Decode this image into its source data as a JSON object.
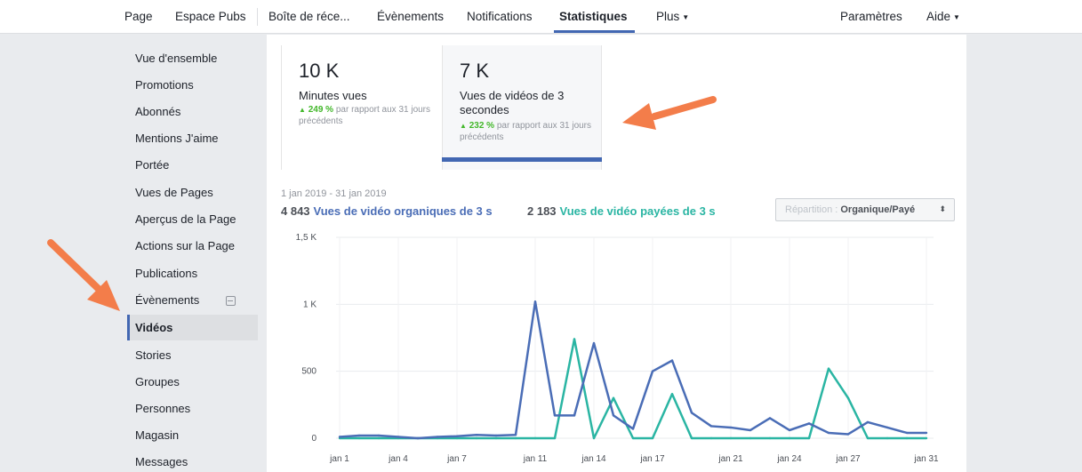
{
  "nav": {
    "items": [
      "Page",
      "Espace Pubs",
      "Boîte de réce...",
      "Évènements",
      "Notifications",
      "Statistiques",
      "Plus",
      "Paramètres",
      "Aide"
    ],
    "active": "Statistiques"
  },
  "sidebar": {
    "items": [
      "Vue d'ensemble",
      "Promotions",
      "Abonnés",
      "Mentions J'aime",
      "Portée",
      "Vues de Pages",
      "Aperçus de la Page",
      "Actions sur la Page",
      "Publications",
      "Évènements",
      "Vidéos",
      "Stories",
      "Groupes",
      "Personnes",
      "Magasin",
      "Messages"
    ],
    "active": "Vidéos"
  },
  "metrics": [
    {
      "value": "10 K",
      "label": "Minutes vues",
      "pct": "249 %",
      "change_text": "par rapport aux 31 jours précédents"
    },
    {
      "value": "7 K",
      "label": "Vues de vidéos de 3 secondes",
      "pct": "232 %",
      "change_text": "par rapport aux 31 jours précédents"
    }
  ],
  "date_range": "1 jan 2019 - 31 jan 2019",
  "legend": {
    "organic_total": "4 843",
    "organic_label": "Vues de vidéo organiques de 3 s",
    "paid_total": "2 183",
    "paid_label": "Vues de vidéo payées de 3 s"
  },
  "dropdown": {
    "label": "Répartition :",
    "value": "Organique/Payé",
    "icon": "updown-arrows-icon"
  },
  "colors": {
    "accent": "#4267b2",
    "organic": "#4a6db6",
    "paid": "#2ab5a3",
    "positive": "#42b72a",
    "annotation": "#f37d4a"
  },
  "chart_data": {
    "type": "line",
    "x": [
      1,
      2,
      3,
      4,
      5,
      6,
      7,
      8,
      9,
      10,
      11,
      12,
      13,
      14,
      15,
      16,
      17,
      18,
      19,
      20,
      21,
      22,
      23,
      24,
      25,
      26,
      27,
      28,
      29,
      30,
      31
    ],
    "x_tick_labels": [
      "jan 1",
      "jan 4",
      "jan 7",
      "jan 11",
      "jan 14",
      "jan 17",
      "jan 21",
      "jan 24",
      "jan 27",
      "jan 31"
    ],
    "x_tick_days": [
      1,
      4,
      7,
      11,
      14,
      17,
      21,
      24,
      27,
      31
    ],
    "y_ticks": [
      0,
      500,
      1000,
      1500
    ],
    "y_tick_labels": [
      "0",
      "500",
      "1 K",
      "1,5 K"
    ],
    "ylim": [
      0,
      1500
    ],
    "grid": true,
    "series": [
      {
        "name": "Vues de vidéo organiques de 3 s",
        "color": "#4a6db6",
        "values": [
          10,
          20,
          20,
          10,
          0,
          10,
          15,
          25,
          20,
          25,
          1020,
          170,
          170,
          710,
          170,
          70,
          500,
          580,
          190,
          90,
          80,
          60,
          150,
          60,
          110,
          40,
          30,
          120,
          80,
          40,
          40
        ]
      },
      {
        "name": "Vues de vidéo payées de 3 s",
        "color": "#2ab5a3",
        "values": [
          0,
          0,
          0,
          0,
          0,
          0,
          0,
          0,
          0,
          0,
          0,
          0,
          740,
          0,
          300,
          0,
          0,
          330,
          0,
          0,
          0,
          0,
          0,
          0,
          0,
          520,
          300,
          0,
          0,
          0,
          0
        ]
      }
    ]
  }
}
